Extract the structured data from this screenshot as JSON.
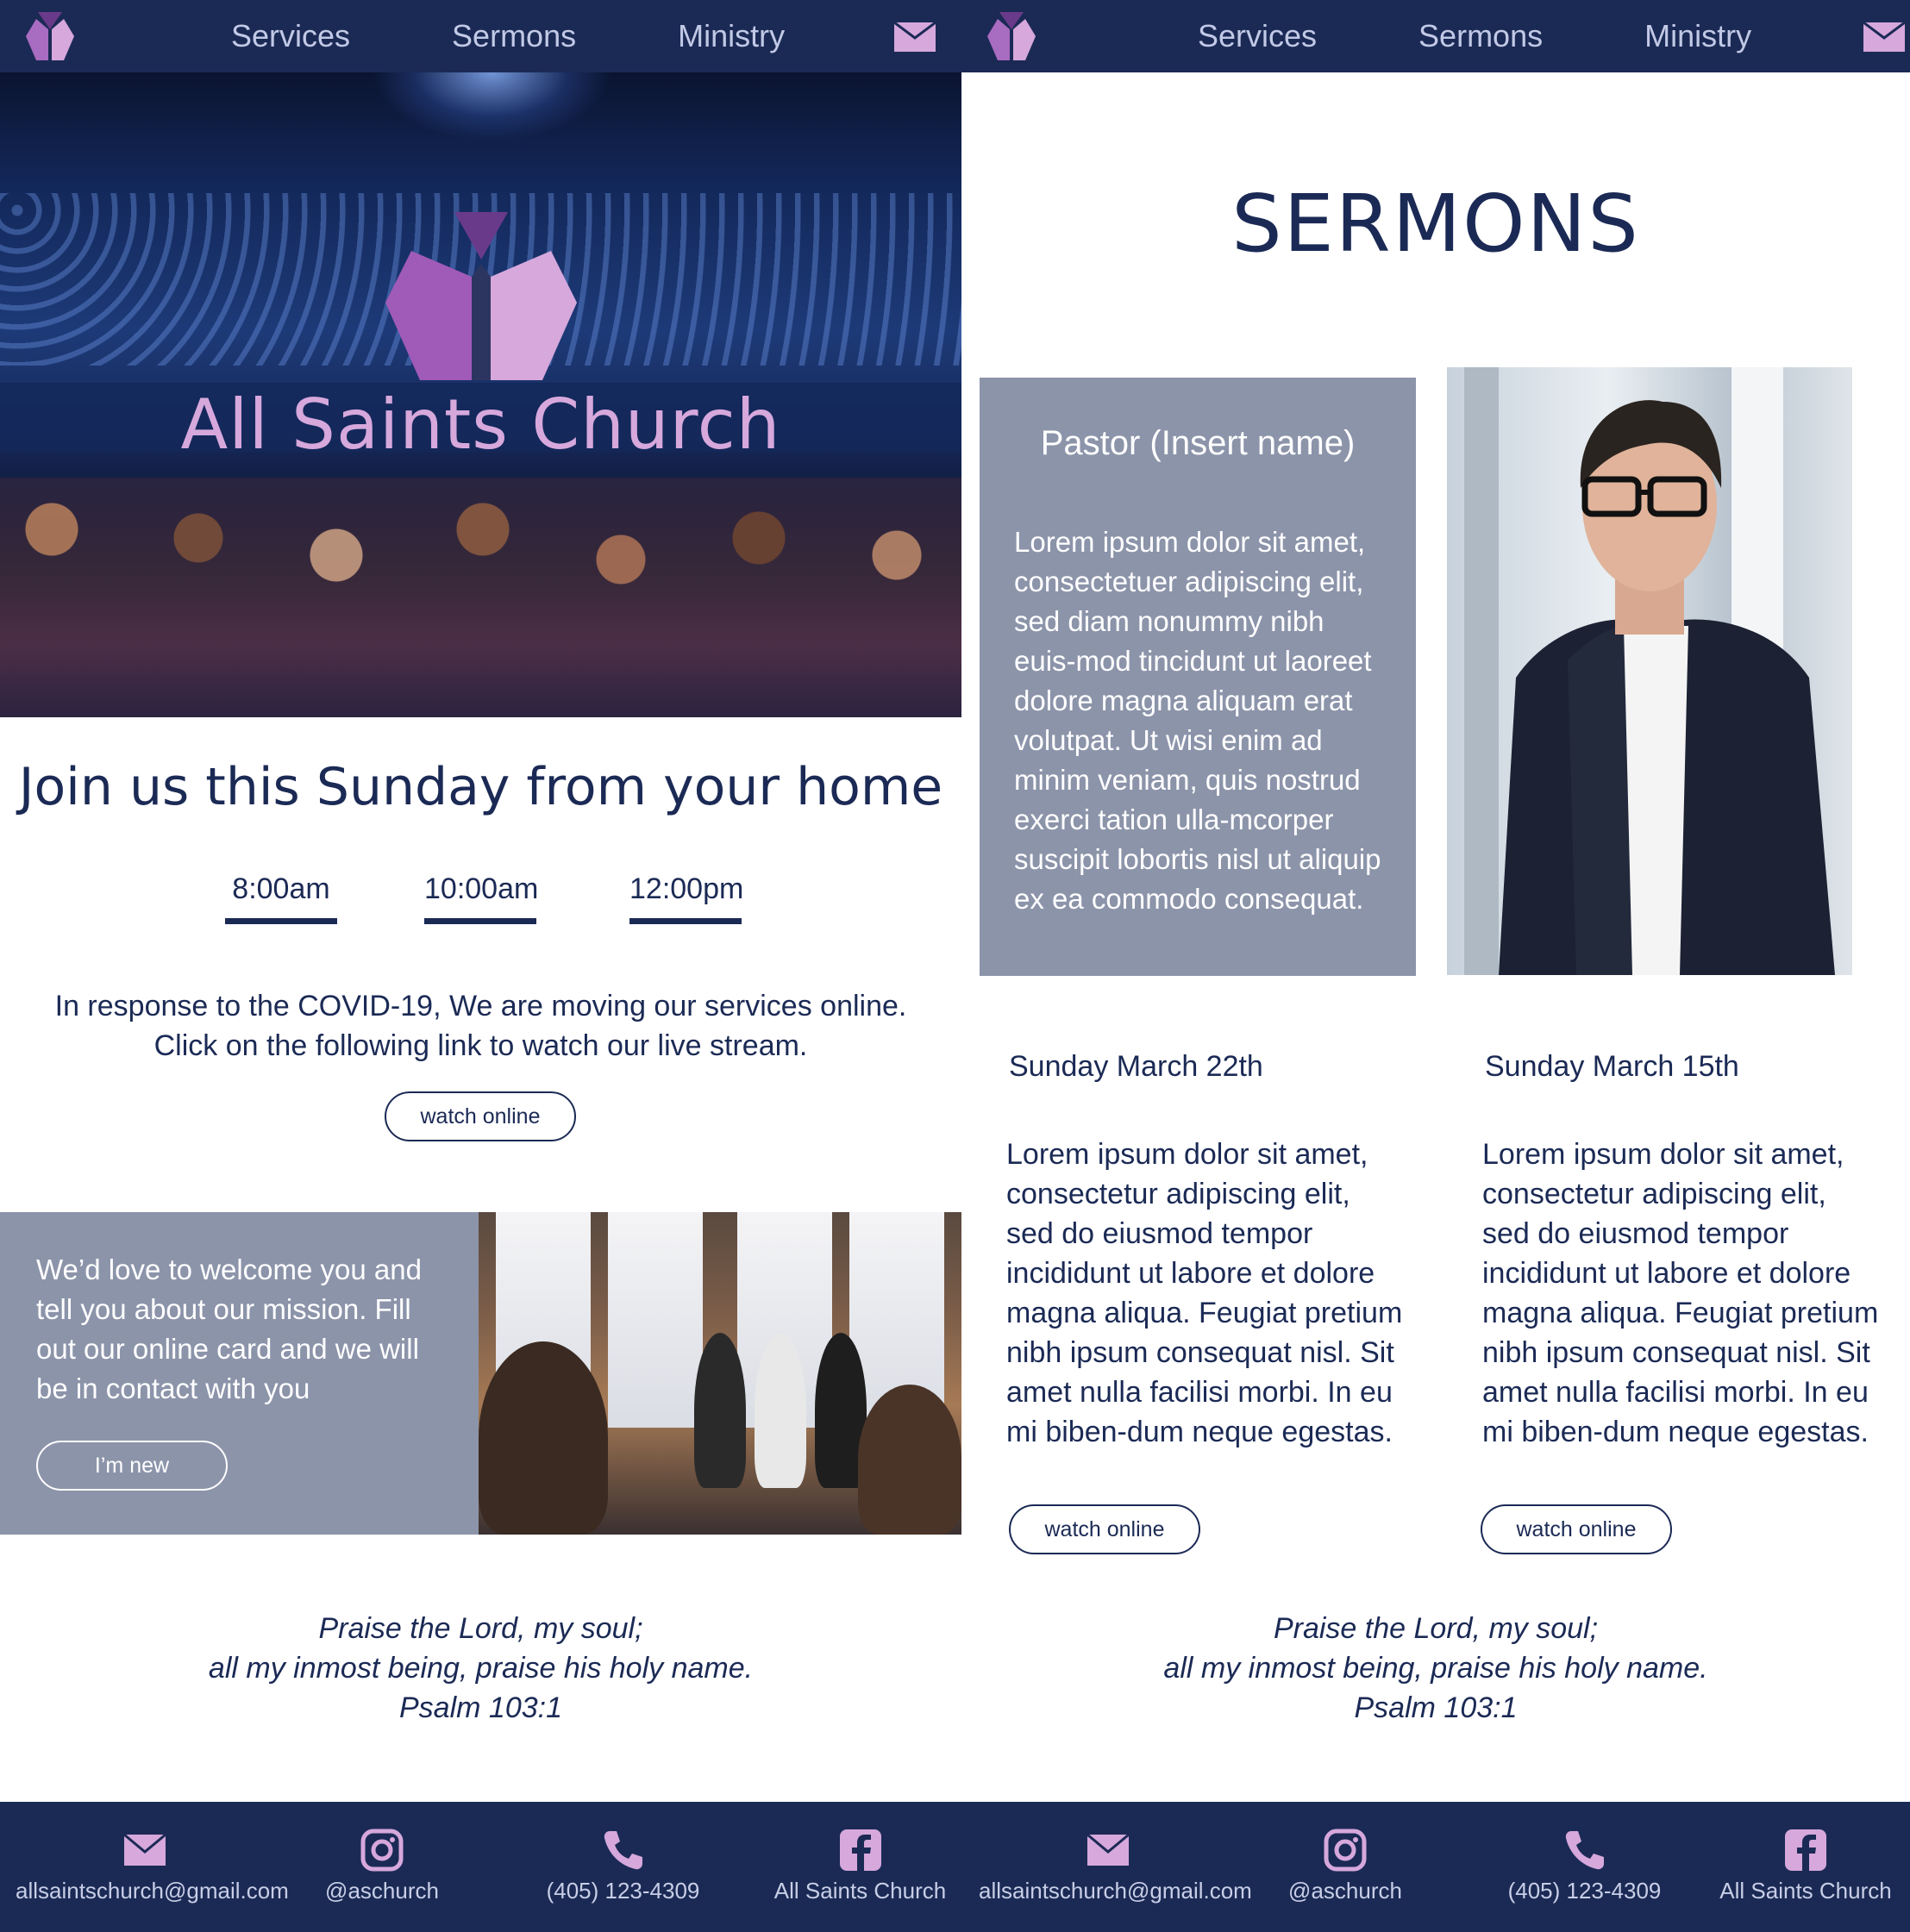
{
  "nav": {
    "links": [
      "Services",
      "Sermons",
      "Ministry"
    ]
  },
  "home": {
    "hero_title": "All Saints Church",
    "join_title": "Join us this Sunday from your home",
    "times": [
      "8:00am",
      "10:00am",
      "12:00pm"
    ],
    "covid_text": "In response to the COVID-19, We are moving our services online. Click on the following link to watch our live stream.",
    "watch_button": "watch online",
    "welcome_text": "We’d love to welcome you and tell you about our mission. Fill out our online card and we will be in contact with you",
    "new_button": "I’m new"
  },
  "sermons": {
    "title": "SERMONS",
    "pastor_name": "Pastor (Insert name)",
    "pastor_bio": "Lorem ipsum dolor sit amet, consectetuer adipiscing elit, sed diam nonummy nibh euis-mod tincidunt ut laoreet dolore magna aliquam erat volutpat. Ut wisi enim ad minim veniam, quis nostrud exerci tation ulla-mcorper suscipit lobortis nisl ut aliquip ex ea commodo consequat.",
    "items": [
      {
        "date": "Sunday March 22th",
        "text": "Lorem ipsum dolor sit amet, consectetur adipiscing elit, sed do eiusmod tempor incididunt ut labore et dolore magna aliqua. Feugiat pretium nibh ipsum consequat nisl. Sit amet nulla facilisi morbi. In eu mi biben-dum neque egestas.",
        "button": "watch online"
      },
      {
        "date": "Sunday March 15th",
        "text": "Lorem ipsum dolor sit amet, consectetur adipiscing elit, sed do eiusmod tempor incididunt ut labore et dolore magna aliqua. Feugiat pretium nibh ipsum consequat nisl. Sit amet nulla facilisi morbi. In eu mi biben-dum neque egestas.",
        "button": "watch online"
      }
    ]
  },
  "verse": {
    "line1": "Praise the Lord, my soul;",
    "line2": "all my inmost being, praise his holy name.",
    "reference": "Psalm 103:1"
  },
  "footer": {
    "email": "allsaintschurch@gmail.com",
    "instagram": "@aschurch",
    "phone": "(405) 123-4309",
    "facebook": "All Saints Church"
  },
  "icons": {
    "logo": "church-logo-icon",
    "mail": "mail-icon",
    "instagram": "instagram-icon",
    "phone": "phone-icon",
    "facebook": "facebook-icon"
  },
  "colors": {
    "navy": "#1b2a55",
    "nav_text": "#c2c9e6",
    "slate": "#8c94aa",
    "logo_pink": "#d6a8dc",
    "logo_purple": "#9b5aa8"
  }
}
